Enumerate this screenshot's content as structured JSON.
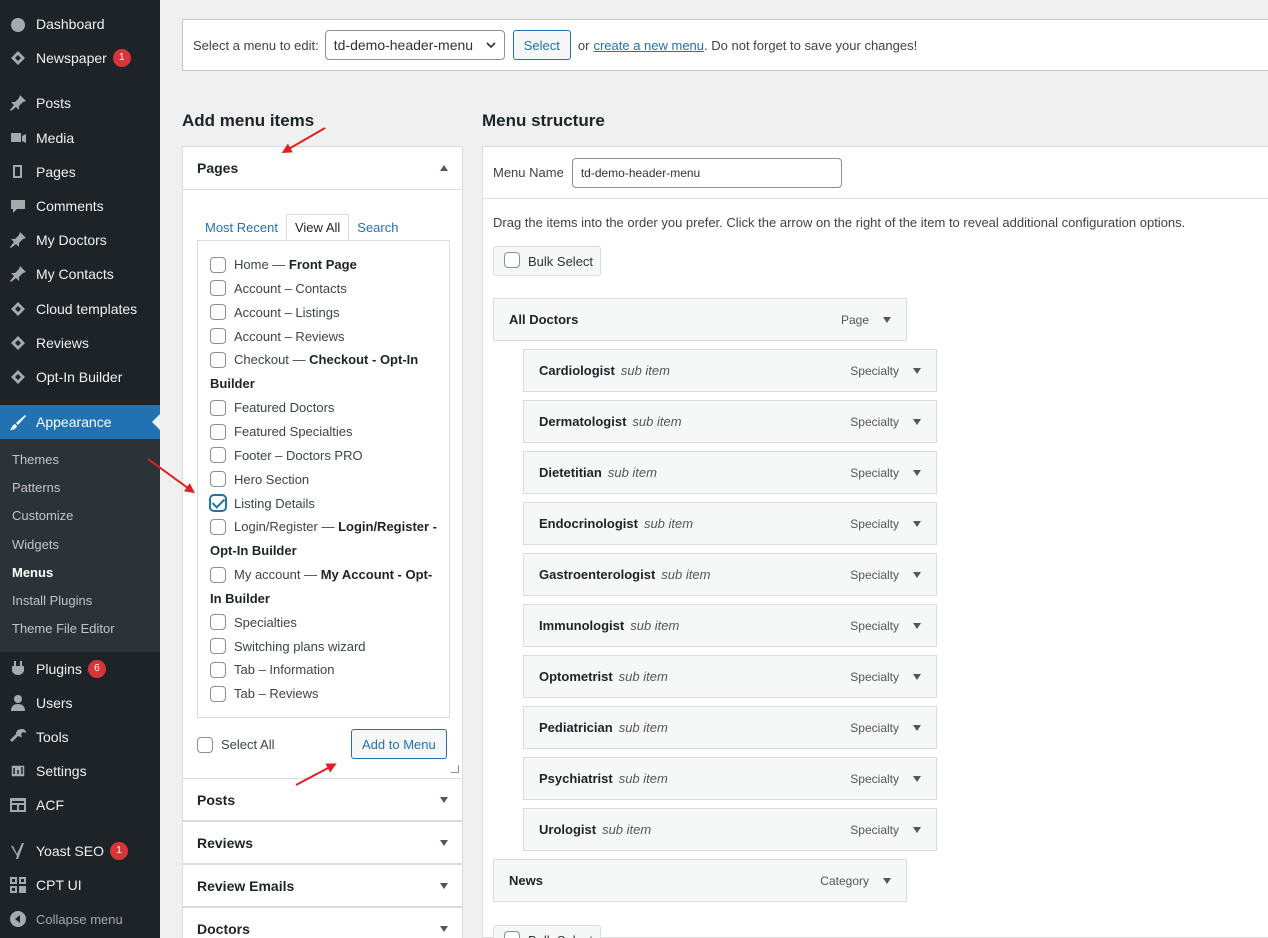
{
  "sidebar": {
    "items": [
      {
        "label": "Dashboard",
        "icon": "dashboard-icon"
      },
      {
        "label": "Newspaper",
        "icon": "newspaper-icon",
        "badge": "1"
      },
      {
        "label": "Posts",
        "icon": "pin-icon"
      },
      {
        "label": "Media",
        "icon": "media-icon"
      },
      {
        "label": "Pages",
        "icon": "pages-icon"
      },
      {
        "label": "Comments",
        "icon": "comments-icon"
      },
      {
        "label": "My Doctors",
        "icon": "pin-icon"
      },
      {
        "label": "My Contacts",
        "icon": "pin-icon"
      },
      {
        "label": "Cloud templates",
        "icon": "newspaper-icon"
      },
      {
        "label": "Reviews",
        "icon": "newspaper-icon"
      },
      {
        "label": "Opt-In Builder",
        "icon": "newspaper-icon"
      },
      {
        "label": "Appearance",
        "icon": "brush-icon"
      },
      {
        "label": "Plugins",
        "icon": "plugin-icon",
        "badge": "6"
      },
      {
        "label": "Users",
        "icon": "users-icon"
      },
      {
        "label": "Tools",
        "icon": "tools-icon"
      },
      {
        "label": "Settings",
        "icon": "settings-icon"
      },
      {
        "label": "ACF",
        "icon": "acf-icon"
      },
      {
        "label": "Yoast SEO",
        "icon": "yoast-icon",
        "badge": "1"
      },
      {
        "label": "CPT UI",
        "icon": "cptui-icon"
      },
      {
        "label": "Collapse menu",
        "icon": "collapse-icon"
      }
    ],
    "submenu": [
      "Themes",
      "Patterns",
      "Customize",
      "Widgets",
      "Menus",
      "Install Plugins",
      "Theme File Editor"
    ]
  },
  "select_bar": {
    "prefix": "Select a menu to edit:",
    "selected_menu": "td-demo-header-menu",
    "select_button": "Select",
    "or_text": "or",
    "create_link": "create a new menu",
    "suffix": ". Do not forget to save your changes!"
  },
  "add_items": {
    "heading": "Add menu items",
    "pages_title": "Pages",
    "tabs": [
      "Most Recent",
      "View All",
      "Search"
    ],
    "pages": [
      {
        "label": "Home",
        "suffix": "Front Page",
        "checked": false
      },
      {
        "label": "Account – Contacts",
        "checked": false
      },
      {
        "label": "Account – Listings",
        "checked": false
      },
      {
        "label": "Account – Reviews",
        "checked": false
      },
      {
        "label": "Checkout",
        "suffix": "Checkout - Opt-In Builder",
        "checked": false
      },
      {
        "label": "Featured Doctors",
        "checked": false
      },
      {
        "label": "Featured Specialties",
        "checked": false
      },
      {
        "label": "Footer – Doctors PRO",
        "checked": false
      },
      {
        "label": "Hero Section",
        "checked": false
      },
      {
        "label": "Listing Details",
        "checked": true
      },
      {
        "label": "Login/Register",
        "suffix": "Login/Register - Opt-In Builder",
        "checked": false
      },
      {
        "label": "My account",
        "suffix": "My Account - Opt-In Builder",
        "checked": false
      },
      {
        "label": "Specialties",
        "checked": false
      },
      {
        "label": "Switching plans wizard",
        "checked": false
      },
      {
        "label": "Tab – Information",
        "checked": false
      },
      {
        "label": "Tab – Reviews",
        "checked": false
      }
    ],
    "select_all": "Select All",
    "add_button": "Add to Menu",
    "other_sections": [
      "Posts",
      "Reviews",
      "Review Emails",
      "Doctors"
    ]
  },
  "structure": {
    "heading": "Menu structure",
    "name_label": "Menu Name",
    "name_value": "td-demo-header-menu",
    "instructions": "Drag the items into the order you prefer. Click the arrow on the right of the item to reveal additional configuration options.",
    "bulk_select": "Bulk Select",
    "sub_label": "sub item",
    "items": [
      {
        "title": "All Doctors",
        "type": "Page",
        "level": 0
      },
      {
        "title": "Cardiologist",
        "type": "Specialty",
        "level": 1
      },
      {
        "title": "Dermatologist",
        "type": "Specialty",
        "level": 1
      },
      {
        "title": "Dietetitian",
        "type": "Specialty",
        "level": 1
      },
      {
        "title": "Endocrinologist",
        "type": "Specialty",
        "level": 1
      },
      {
        "title": "Gastroenterologist",
        "type": "Specialty",
        "level": 1
      },
      {
        "title": "Immunologist",
        "type": "Specialty",
        "level": 1
      },
      {
        "title": "Optometrist",
        "type": "Specialty",
        "level": 1
      },
      {
        "title": "Pediatrician",
        "type": "Specialty",
        "level": 1
      },
      {
        "title": "Psychiatrist",
        "type": "Specialty",
        "level": 1
      },
      {
        "title": "Urologist",
        "type": "Specialty",
        "level": 1
      },
      {
        "title": "News",
        "type": "Category",
        "level": 0
      }
    ]
  },
  "colors": {
    "admin_bar": "#1d2327",
    "accent": "#2271b1",
    "badge": "#d63638",
    "annotation_arrow": "#e02020"
  }
}
